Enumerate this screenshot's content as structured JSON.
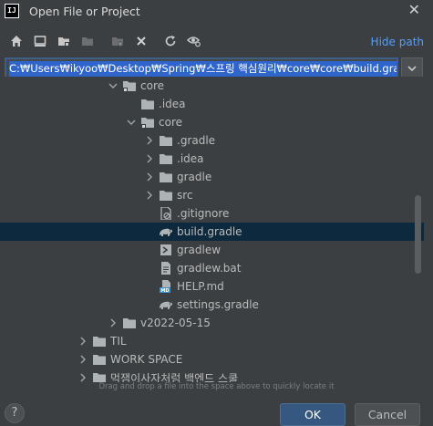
{
  "window": {
    "logo_text": "IJ",
    "title": "Open File or Project",
    "close": "✕"
  },
  "toolbar": {
    "buttons": [
      {
        "name": "home-icon"
      },
      {
        "name": "desktop-icon"
      },
      {
        "name": "project-directory-icon"
      },
      {
        "name": "module-directory-icon"
      },
      {
        "name": "new-folder-icon"
      },
      {
        "name": "delete-icon"
      },
      {
        "name": "refresh-icon"
      },
      {
        "name": "show-hidden-icon"
      }
    ],
    "hide_path_label": "Hide path"
  },
  "path": {
    "value": "C:₩Users₩ikyoo₩Desktop₩Spring₩스프링 핵심원리₩core₩core₩build.gradle"
  },
  "tree": {
    "items": [
      {
        "label": "core",
        "expanded": true,
        "icon": "module-folder"
      },
      {
        "label": ".idea",
        "expanded": false,
        "icon": "folder",
        "leaf": true
      },
      {
        "label": "core",
        "expanded": true,
        "icon": "module-folder"
      },
      {
        "label": ".gradle",
        "expanded": false,
        "icon": "folder"
      },
      {
        "label": ".idea",
        "expanded": false,
        "icon": "folder"
      },
      {
        "label": "gradle",
        "expanded": false,
        "icon": "folder"
      },
      {
        "label": "src",
        "expanded": false,
        "icon": "folder"
      },
      {
        "label": ".gitignore",
        "icon": "gitignore-file"
      },
      {
        "label": "build.gradle",
        "icon": "gradle-file",
        "selected": true
      },
      {
        "label": "gradlew",
        "icon": "executable-file"
      },
      {
        "label": "gradlew.bat",
        "icon": "text-file"
      },
      {
        "label": "HELP.md",
        "icon": "markdown-file"
      },
      {
        "label": "settings.gradle",
        "icon": "gradle-file"
      },
      {
        "label": "v2022-05-15",
        "expanded": false,
        "icon": "folder"
      },
      {
        "label": "TIL",
        "expanded": false,
        "icon": "folder"
      },
      {
        "label": "WORK SPACE",
        "expanded": false,
        "icon": "folder"
      },
      {
        "label": "먹잼이사자처럼 백엔드 스쿨",
        "expanded": false,
        "icon": "folder"
      }
    ]
  },
  "hint": "Drag and drop a file into the space above to quickly locate it",
  "footer": {
    "help": "?",
    "ok": "OK",
    "cancel": "Cancel"
  },
  "colors": {
    "background": "#3c3f41",
    "selection": "#0d293e",
    "accent": "#589df6",
    "primary_button": "#365880"
  }
}
